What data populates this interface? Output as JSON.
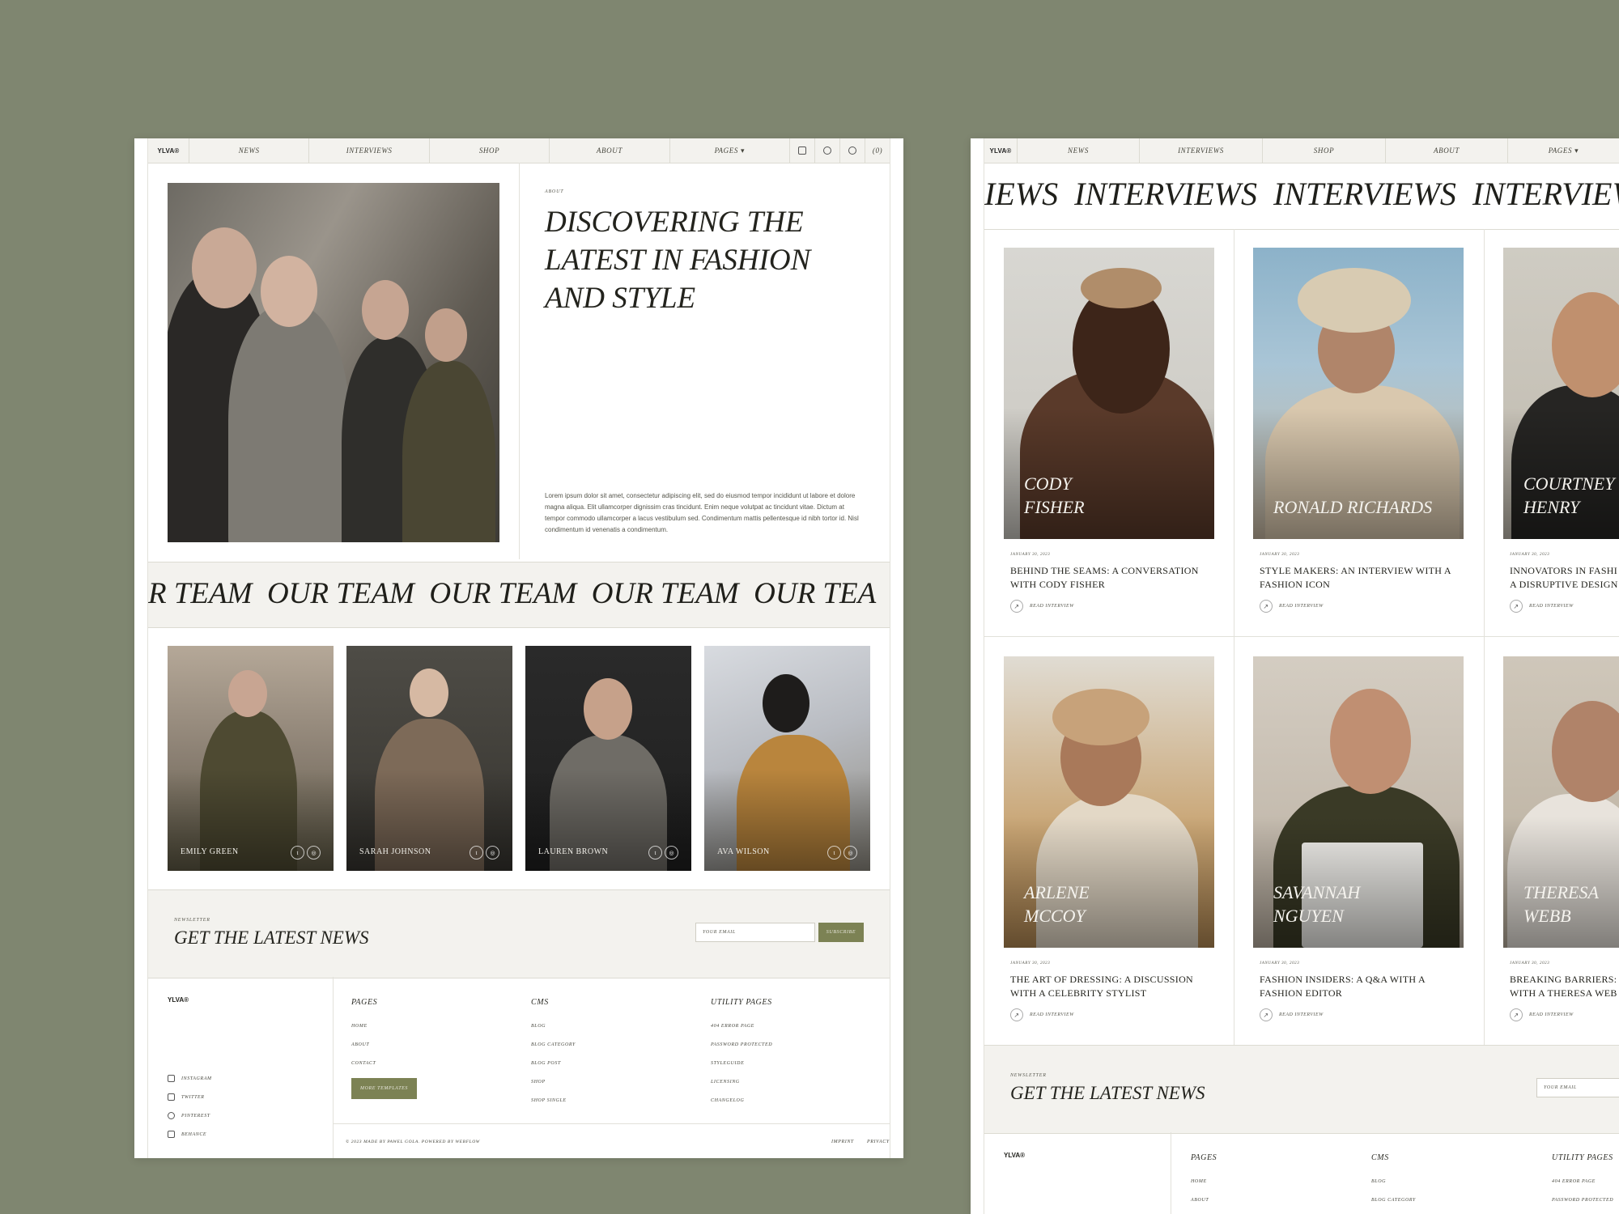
{
  "colors": {
    "background": "#7f8670",
    "accent": "#7c8254",
    "panel": "#f3f2ee",
    "text": "#1f1f1a"
  },
  "nav": {
    "logo": "YLVA®",
    "items": [
      "NEWS",
      "INTERVIEWS",
      "SHOP",
      "ABOUT",
      "PAGES"
    ],
    "pages_caret": "▾",
    "icons": [
      "instagram-icon",
      "pinterest-icon",
      "chat-icon"
    ],
    "cart": "(0)"
  },
  "hero": {
    "label": "ABOUT",
    "title_lines": [
      "DISCOVERING THE",
      "LATEST IN FASHION",
      "AND STYLE"
    ],
    "body": "Lorem ipsum dolor sit amet, consectetur adipiscing elit, sed do eiusmod tempor incididunt ut labore et dolore magna aliqua. Elit ullamcorper dignissim cras tincidunt. Enim neque volutpat ac tincidunt vitae. Dictum at tempor commodo ullamcorper a lacus vestibulum sed. Condimentum mattis pellentesque id nibh tortor id. Nisl condimentum id venenatis a condimentum."
  },
  "team": {
    "marquee": "R TEAM  OUR TEAM  OUR TEAM  OUR TEAM  OUR TEA",
    "members": [
      {
        "name": "EMILY GREEN"
      },
      {
        "name": "SARAH JOHNSON"
      },
      {
        "name": "LAUREN BROWN"
      },
      {
        "name": "AVA WILSON"
      }
    ]
  },
  "newsletter": {
    "label": "NEWSLETTER",
    "title": "GET THE LATEST NEWS",
    "email_placeholder": "YOUR EMAIL",
    "subscribe": "SUBSCRIBE"
  },
  "footer": {
    "logo": "YLVA®",
    "social": [
      "INSTAGRAM",
      "TWITTER",
      "PINTEREST",
      "BEHANCE"
    ],
    "columns": [
      {
        "title": "PAGES",
        "links": [
          "HOME",
          "ABOUT",
          "CONTACT"
        ]
      },
      {
        "title": "CMS",
        "links": [
          "BLOG",
          "BLOG CATEGORY",
          "BLOG POST",
          "SHOP",
          "SHOP SINGLE"
        ]
      },
      {
        "title": "UTILITY PAGES",
        "links": [
          "404 ERROR PAGE",
          "PASSWORD PROTECTED",
          "STYLEGUIDE",
          "LICENSING",
          "CHANGELOG"
        ]
      }
    ],
    "more_templates": "MORE TEMPLATES",
    "copyright": "© 2023 MADE BY PAWEL GOLA. POWERED BY WEBFLOW",
    "imprint": "IMPRINT",
    "privacy": "PRIVACY"
  },
  "interviews": {
    "marquee": "IEWS  INTERVIEWS  INTERVIEWS  INTERVIEW",
    "read_label": "READ INTERVIEW",
    "cards": [
      {
        "photo_name": [
          "CODY",
          "FISHER"
        ],
        "date": "JANUARY 30, 2023",
        "title": [
          "BEHIND THE SEAMS: A CONVERSATION",
          "WITH CODY FISHER"
        ]
      },
      {
        "photo_name": [
          "RONALD RICHARDS"
        ],
        "date": "JANUARY 30, 2023",
        "title": [
          "STYLE MAKERS: AN INTERVIEW WITH A",
          "FASHION ICON"
        ]
      },
      {
        "photo_name": [
          "COURTNEY",
          "HENRY"
        ],
        "date": "JANUARY 30, 2023",
        "title": [
          "INNOVATORS IN FASHI",
          "A DISRUPTIVE DESIGN"
        ]
      },
      {
        "photo_name": [
          "ARLENE",
          "MCCOY"
        ],
        "date": "JANUARY 30, 2023",
        "title": [
          "THE ART OF DRESSING: A DISCUSSION",
          "WITH A CELEBRITY STYLIST"
        ]
      },
      {
        "photo_name": [
          "SAVANNAH",
          "NGUYEN"
        ],
        "date": "JANUARY 30, 2023",
        "title": [
          "FASHION INSIDERS: A Q&A WITH A",
          "FASHION EDITOR"
        ]
      },
      {
        "photo_name": [
          "THERESA",
          "WEBB"
        ],
        "date": "JANUARY 30, 2023",
        "title": [
          "BREAKING BARRIERS:",
          "WITH A THERESA WEB"
        ]
      }
    ]
  },
  "right_footer": {
    "columns": [
      {
        "title": "PAGES",
        "links": [
          "HOME",
          "ABOUT"
        ]
      },
      {
        "title": "CMS",
        "links": [
          "BLOG",
          "BLOG CATEGORY"
        ]
      },
      {
        "title": "UTILITY PAGES",
        "links": [
          "404 ERROR PAGE",
          "PASSWORD PROTECTED"
        ]
      }
    ]
  }
}
